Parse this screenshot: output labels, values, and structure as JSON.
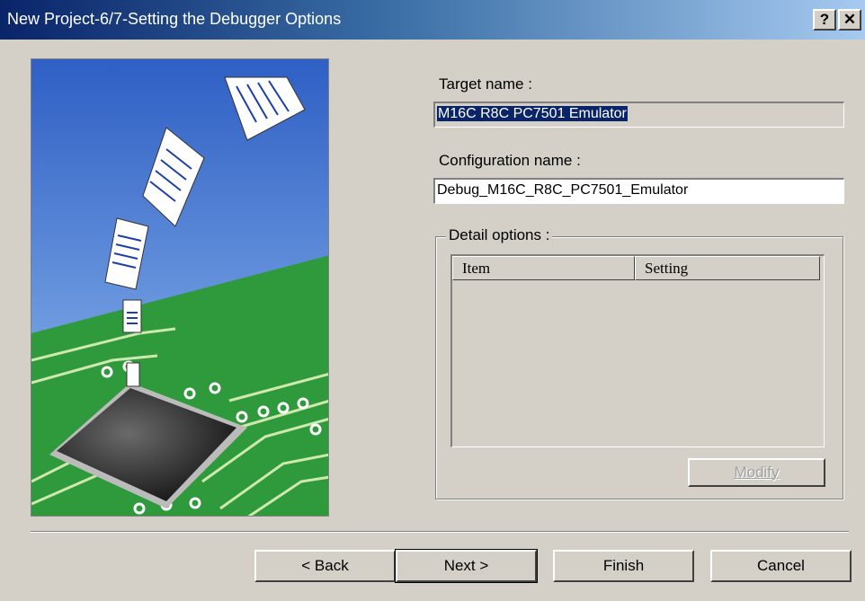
{
  "window": {
    "title": "New Project-6/7-Setting the Debugger Options",
    "help_glyph": "?",
    "close_glyph": "✕"
  },
  "form": {
    "target_label": "Target name :",
    "target_value": "M16C R8C PC7501 Emulator",
    "config_label": "Configuration name :",
    "config_value": "Debug_M16C_R8C_PC7501_Emulator",
    "detail_group_label": "Detail options :",
    "table_headers": [
      "Item",
      "Setting"
    ],
    "table_rows": [],
    "modify_label": "Modify",
    "modify_enabled": false
  },
  "buttons": {
    "back": "< Back",
    "next": "Next >",
    "finish": "Finish",
    "cancel": "Cancel"
  },
  "illustration": {
    "sky_color": "#3d6fd0",
    "board_color": "#2e9a3c",
    "icons": [
      "document-icon",
      "chip-icon"
    ]
  }
}
